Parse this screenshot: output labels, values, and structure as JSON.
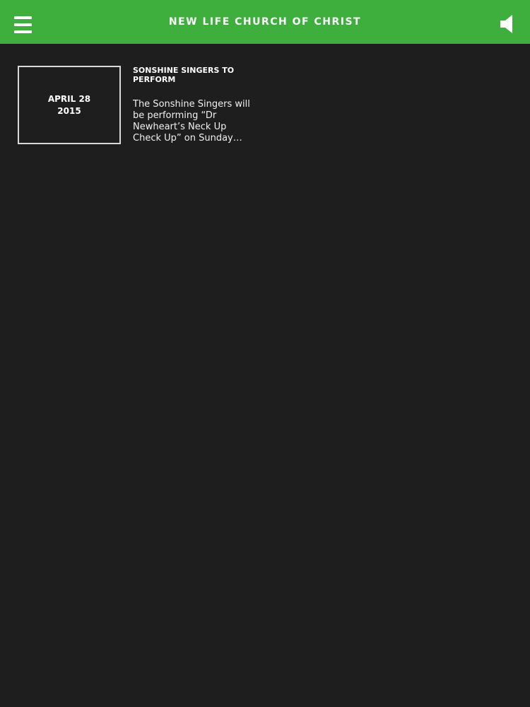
{
  "header": {
    "title": "NEW LIFE CHURCH OF CHRIST",
    "menu_icon": "hamburger-menu-icon",
    "sound_icon": "speaker-icon",
    "background_color": "#3eaf3c"
  },
  "news": [
    {
      "date_line1": "APRIL 28",
      "date_line2": "2015",
      "title": "SONSHINE SINGERS TO PERFORM",
      "excerpt": "The Sonshine Singers will be performing “Dr Newheart’s Neck Up Check Up” on Sunday…"
    }
  ],
  "colors": {
    "background": "#1e1e1f",
    "text": "#ffffff",
    "date_border": "#d9d9d9"
  }
}
